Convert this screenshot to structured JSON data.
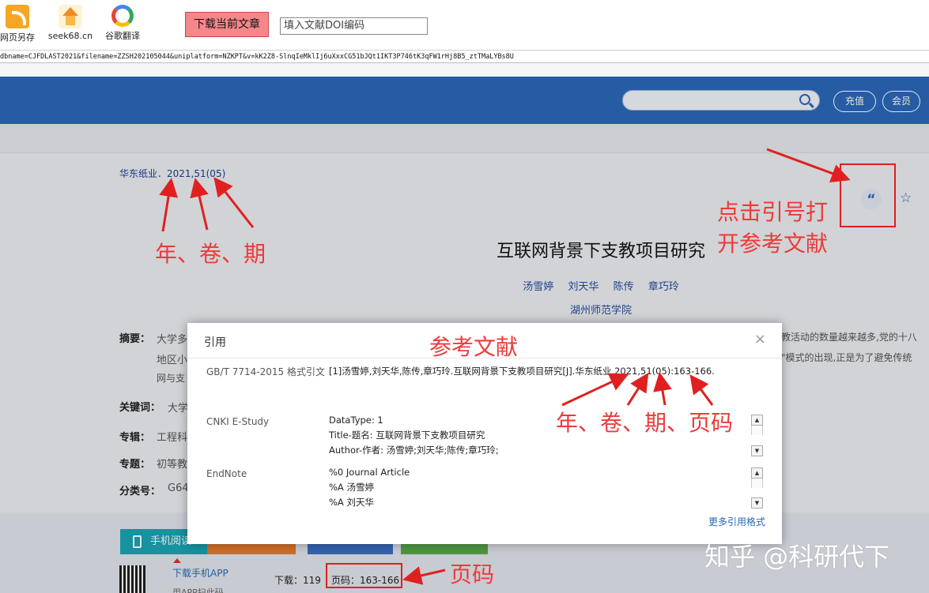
{
  "toolbar": {
    "save_page": "网页另存",
    "seek": "seek68.cn",
    "google_translate": "谷歌翻译",
    "download_current": "下载当前文章",
    "doi_placeholder": "填入文献DOI编码"
  },
  "url": "dbname=CJFDLAST2021&filename=ZZSH202105044&uniplatform=NZKPT&v=kK2Z8-SlnqIeMklIj6uXxxCG51bJQt1IKT3P746tK3qFW1rHj8B5_ztTMaLYBs8U",
  "header": {
    "recharge": "充值",
    "member": "会员"
  },
  "article": {
    "journal_line": "华东纸业．2021,51(05)",
    "title": "互联网背景下支教项目研究",
    "authors": [
      "汤雪婷",
      "刘天华",
      "陈传",
      "章巧玲"
    ],
    "institution": "湖州师范学院",
    "abstract_label": "摘要：",
    "abstract_start": "大学多",
    "abstract_line2_start": "地区小",
    "abstract_line3_start": "网与支",
    "abstract_right1": "教活动的数量越来越多,党的十八",
    "abstract_right2": "\"模式的出现,正是为了避免传统",
    "keywords_label": "关键词：",
    "keywords_value": "大学",
    "category_label": "专辑：",
    "category_value": "工程科",
    "topic_label": "专题：",
    "topic_value": "初等教",
    "class_label": "分类号：",
    "class_value": "G64"
  },
  "bottom": {
    "mobile_read": "手机阅读",
    "download_app": "下载手机APP",
    "app_sub": "用APP扫此码",
    "downloads": "下载：119",
    "pages": "页码：163-166"
  },
  "dialog": {
    "title": "引用",
    "gbt_label": "GB/T 7714-2015 格式引文",
    "gbt_text": "[1]汤雪婷,刘天华,陈传,章巧玲.互联网背景下支教项目研究[J].华东纸业,2021,51(05):163-166.",
    "estudy_label": "CNKI E-Study",
    "estudy_lines": [
      "DataType: 1",
      "Title-题名: 互联网背景下支教项目研究",
      "Author-作者: 汤雪婷;刘天华;陈传;章巧玲;"
    ],
    "endnote_label": "EndNote",
    "endnote_lines": [
      "%0 Journal Article",
      "%A 汤雪婷",
      "%A 刘天华"
    ],
    "more_formats": "更多引用格式"
  },
  "annotations": {
    "year_vol_issue": "年、卷、期",
    "references": "参考文献",
    "click_quote_line1": "点击引号打",
    "click_quote_line2": "开参考文献",
    "year_vol_issue_pages": "年、卷、期、页码",
    "pages": "页码"
  },
  "watermark": "知乎 @科研代下",
  "colors": {
    "header_blue": "#2a67b7",
    "annotation_red": "#ee3a3a",
    "download_button": "#f4878a"
  }
}
